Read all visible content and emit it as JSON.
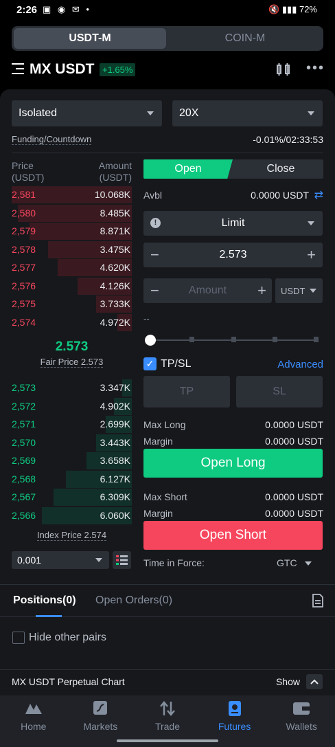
{
  "status_bar": {
    "time": "2:26",
    "battery": "72%"
  },
  "margin_mode_segment": {
    "active": "USDT-M",
    "inactive": "COIN-M"
  },
  "pair": {
    "symbol": "MX USDT",
    "change": "+1.65%"
  },
  "settings": {
    "margin_type": "Isolated",
    "leverage": "20X"
  },
  "funding": {
    "label": "Funding/Countdown",
    "value": "-0.01%/02:33:53"
  },
  "orderbook": {
    "price_header": "Price",
    "price_unit": "(USDT)",
    "amount_header": "Amount",
    "amount_unit": "(USDT)",
    "asks": [
      {
        "price": "2,581",
        "amount": "10.068K",
        "depth": 1.0
      },
      {
        "price": "2,580",
        "amount": "8.485K",
        "depth": 0.95
      },
      {
        "price": "2,579",
        "amount": "8.871K",
        "depth": 0.85
      },
      {
        "price": "2,578",
        "amount": "3.475K",
        "depth": 0.7
      },
      {
        "price": "2,577",
        "amount": "4.620K",
        "depth": 0.62
      },
      {
        "price": "2,576",
        "amount": "4.126K",
        "depth": 0.45
      },
      {
        "price": "2,575",
        "amount": "3.733K",
        "depth": 0.3
      },
      {
        "price": "2,574",
        "amount": "4.972K",
        "depth": 0.12
      }
    ],
    "mid_price": "2.573",
    "fair_price": "Fair Price 2.573",
    "bids": [
      {
        "price": "2,573",
        "amount": "3.347K",
        "depth": 0.08
      },
      {
        "price": "2,572",
        "amount": "4.902K",
        "depth": 0.15
      },
      {
        "price": "2,571",
        "amount": "2.699K",
        "depth": 0.22
      },
      {
        "price": "2,570",
        "amount": "3.443K",
        "depth": 0.3
      },
      {
        "price": "2,569",
        "amount": "3.658K",
        "depth": 0.38
      },
      {
        "price": "2,568",
        "amount": "6.127K",
        "depth": 0.55
      },
      {
        "price": "2,567",
        "amount": "6.309K",
        "depth": 0.65
      },
      {
        "price": "2,566",
        "amount": "6.060K",
        "depth": 0.75
      }
    ],
    "index_price": "Index Price 2.574",
    "precision": "0.001"
  },
  "order_form": {
    "tab_open": "Open",
    "tab_close": "Close",
    "avbl_label": "Avbl",
    "avbl_value": "0.0000 USDT",
    "order_type": "Limit",
    "price_value": "2.573",
    "amount_placeholder": "Amount",
    "amount_unit": "USDT",
    "percent_readout": "--",
    "slider_value": 0,
    "tpsl_label": "TP/SL",
    "advanced_label": "Advanced",
    "tp_label": "TP",
    "sl_label": "SL",
    "max_long_label": "Max Long",
    "max_long_value": "0.0000 USDT",
    "margin_label": "Margin",
    "margin_long_value": "0.0000 USDT",
    "open_long": "Open Long",
    "max_short_label": "Max Short",
    "max_short_value": "0.0000 USDT",
    "margin_short_value": "0.0000 USDT",
    "open_short": "Open Short",
    "tif_label": "Time in Force:",
    "tif_value": "GTC"
  },
  "positions": {
    "tab_positions": "Positions(0)",
    "tab_orders": "Open Orders(0)",
    "hide_pairs": "Hide other pairs"
  },
  "chart_bar": {
    "label": "MX USDT Perpetual Chart",
    "show": "Show"
  },
  "nav": [
    {
      "label": "Home",
      "icon": "home-icon"
    },
    {
      "label": "Markets",
      "icon": "markets-icon"
    },
    {
      "label": "Trade",
      "icon": "trade-icon"
    },
    {
      "label": "Futures",
      "icon": "futures-icon"
    },
    {
      "label": "Wallets",
      "icon": "wallet-icon"
    }
  ],
  "colors": {
    "up": "#0ecb81",
    "down": "#f6465d",
    "accent": "#3a8dff"
  }
}
